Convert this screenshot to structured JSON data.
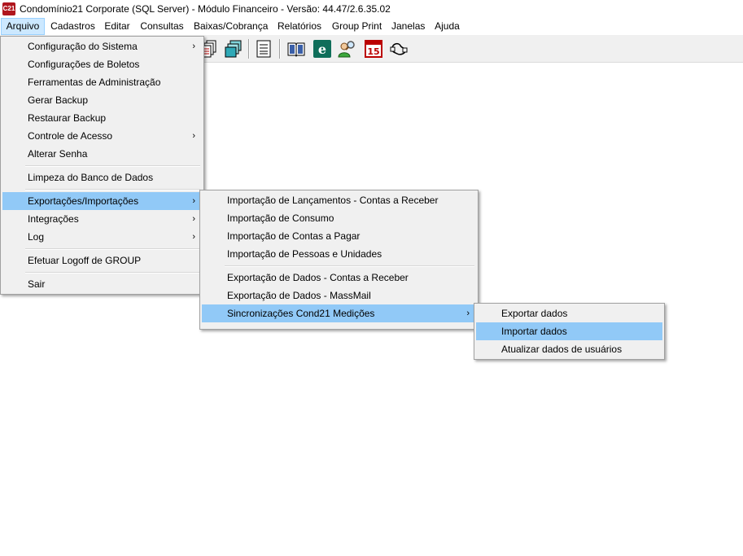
{
  "window": {
    "title": "Condomínio21 Corporate  (SQL Server)  - Módulo Financeiro - Versão: 44.47/2.6.35.02",
    "icon_text": "C21",
    "icon_color": "#b0161e"
  },
  "menubar": {
    "items": [
      {
        "label": "Arquivo"
      },
      {
        "label": "Cadastros"
      },
      {
        "label": "Editar"
      },
      {
        "label": "Consultas"
      },
      {
        "label": "Baixas/Cobrança"
      },
      {
        "label": "Relatórios"
      },
      {
        "label": "Group Print"
      },
      {
        "label": "Janelas"
      },
      {
        "label": "Ajuda"
      }
    ]
  },
  "toolbar": {
    "calendar_day": "15"
  },
  "arquivo_menu": {
    "items": [
      {
        "label": "Configuração do Sistema"
      },
      {
        "label": "Configurações de Boletos"
      },
      {
        "label": "Ferramentas de Administração"
      },
      {
        "label": "Gerar Backup"
      },
      {
        "label": "Restaurar Backup"
      },
      {
        "label": "Controle de Acesso"
      },
      {
        "label": "Alterar Senha"
      },
      {
        "label": "Limpeza do Banco de Dados"
      },
      {
        "label": "Exportações/Importações"
      },
      {
        "label": "Integrações"
      },
      {
        "label": "Log"
      },
      {
        "label": "Efetuar Logoff de GROUP"
      },
      {
        "label": "Sair"
      }
    ]
  },
  "export_import_menu": {
    "items": [
      {
        "label": "Importação de Lançamentos - Contas a Receber"
      },
      {
        "label": "Importação de Consumo"
      },
      {
        "label": "Importação de Contas a Pagar"
      },
      {
        "label": "Importação de Pessoas e Unidades"
      },
      {
        "label": "Exportação de Dados - Contas a Receber"
      },
      {
        "label": "Exportação de Dados - MassMail"
      },
      {
        "label": "Sincronizações Cond21 Medições"
      }
    ]
  },
  "sync_menu": {
    "items": [
      {
        "label": "Exportar dados"
      },
      {
        "label": "Importar dados"
      },
      {
        "label": "Atualizar dados de usuários"
      }
    ]
  },
  "colors": {
    "menu_highlight": "#91c9f7",
    "menubar_active": "#cce8ff",
    "menu_background": "#f0f0f0"
  }
}
